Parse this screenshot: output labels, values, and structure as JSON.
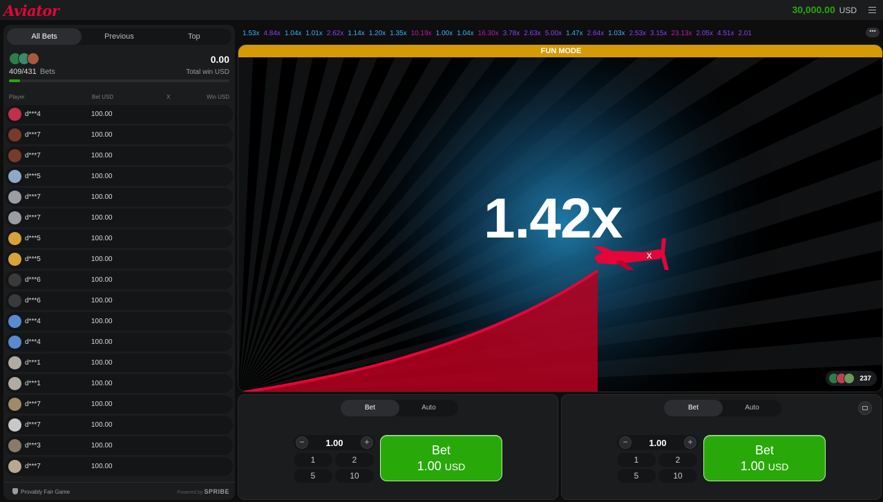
{
  "header": {
    "logo": "Aviator",
    "balance": "30,000.00",
    "currency": "USD"
  },
  "left_panel": {
    "tabs": [
      "All Bets",
      "Previous",
      "Top"
    ],
    "active_tab": "All Bets",
    "bets_count": "409/431",
    "bets_label": "Bets",
    "total_win": "0.00",
    "total_win_label": "Total win USD",
    "progress_fraction": 0.05,
    "columns": {
      "player": "Player",
      "bet": "Bet USD",
      "x": "X",
      "win": "Win USD"
    },
    "rows": [
      {
        "player": "d***4",
        "bet": "100.00",
        "avatar_color": "#c0304a"
      },
      {
        "player": "d***7",
        "bet": "100.00",
        "avatar_color": "#7a3a2a"
      },
      {
        "player": "d***7",
        "bet": "100.00",
        "avatar_color": "#7a3a2a"
      },
      {
        "player": "d***5",
        "bet": "100.00",
        "avatar_color": "#8fa8c8"
      },
      {
        "player": "d***7",
        "bet": "100.00",
        "avatar_color": "#9a9ea4"
      },
      {
        "player": "d***7",
        "bet": "100.00",
        "avatar_color": "#9a9ea4"
      },
      {
        "player": "d***5",
        "bet": "100.00",
        "avatar_color": "#d8a23a"
      },
      {
        "player": "d***5",
        "bet": "100.00",
        "avatar_color": "#d8a23a"
      },
      {
        "player": "d***6",
        "bet": "100.00",
        "avatar_color": "#3a3a3a"
      },
      {
        "player": "d***6",
        "bet": "100.00",
        "avatar_color": "#3a3a3a"
      },
      {
        "player": "d***4",
        "bet": "100.00",
        "avatar_color": "#5a8ad0"
      },
      {
        "player": "d***4",
        "bet": "100.00",
        "avatar_color": "#5a8ad0"
      },
      {
        "player": "d***1",
        "bet": "100.00",
        "avatar_color": "#b0aca4"
      },
      {
        "player": "d***1",
        "bet": "100.00",
        "avatar_color": "#b0aca4"
      },
      {
        "player": "d***7",
        "bet": "100.00",
        "avatar_color": "#a08a6a"
      },
      {
        "player": "d***7",
        "bet": "100.00",
        "avatar_color": "#c8c8c8"
      },
      {
        "player": "d***3",
        "bet": "100.00",
        "avatar_color": "#8a7a6a"
      },
      {
        "player": "d***7",
        "bet": "100.00",
        "avatar_color": "#b8a890"
      }
    ],
    "footer": {
      "provably_fair": "Provably Fair Game",
      "powered_by": "Powered by",
      "brand": "SPRIBE"
    }
  },
  "history": [
    {
      "value": "1.53x",
      "color": "blue"
    },
    {
      "value": "4.84x",
      "color": "purple"
    },
    {
      "value": "1.04x",
      "color": "blue"
    },
    {
      "value": "1.01x",
      "color": "blue"
    },
    {
      "value": "2.62x",
      "color": "purple"
    },
    {
      "value": "1.14x",
      "color": "blue"
    },
    {
      "value": "1.20x",
      "color": "blue"
    },
    {
      "value": "1.35x",
      "color": "blue"
    },
    {
      "value": "10.19x",
      "color": "pink"
    },
    {
      "value": "1.00x",
      "color": "blue"
    },
    {
      "value": "1.04x",
      "color": "blue"
    },
    {
      "value": "16.30x",
      "color": "pink"
    },
    {
      "value": "3.78x",
      "color": "purple"
    },
    {
      "value": "2.63x",
      "color": "purple"
    },
    {
      "value": "5.00x",
      "color": "purple"
    },
    {
      "value": "1.47x",
      "color": "blue"
    },
    {
      "value": "2.64x",
      "color": "purple"
    },
    {
      "value": "1.03x",
      "color": "blue"
    },
    {
      "value": "2.53x",
      "color": "purple"
    },
    {
      "value": "3.15x",
      "color": "purple"
    },
    {
      "value": "23.13x",
      "color": "pink"
    },
    {
      "value": "2.05x",
      "color": "purple"
    },
    {
      "value": "4.51x",
      "color": "purple"
    },
    {
      "value": "2.01",
      "color": "purple"
    }
  ],
  "stage": {
    "banner": "FUN MODE",
    "multiplier": "1.42x",
    "players_online": "237"
  },
  "bet_panels": [
    {
      "tabs": [
        "Bet",
        "Auto"
      ],
      "amount": "1.00",
      "quick": [
        "1",
        "2",
        "5",
        "10"
      ],
      "button_label": "Bet",
      "button_amount": "1.00",
      "button_currency": "USD"
    },
    {
      "tabs": [
        "Bet",
        "Auto"
      ],
      "amount": "1.00",
      "quick": [
        "1",
        "2",
        "5",
        "10"
      ],
      "button_label": "Bet",
      "button_amount": "1.00",
      "button_currency": "USD"
    }
  ],
  "colors": {
    "accent_red": "#e50539",
    "green": "#28a909",
    "fun_mode": "#d69a06"
  }
}
